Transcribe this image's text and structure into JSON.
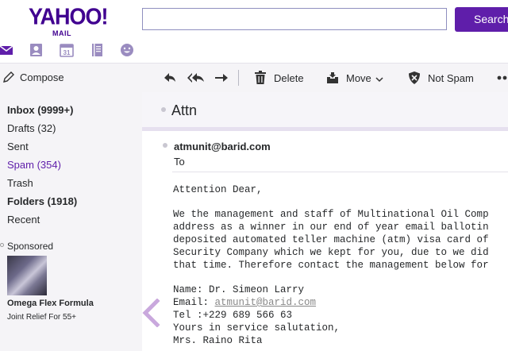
{
  "logo": {
    "word": "YAHOO!",
    "sub": "MAIL"
  },
  "search": {
    "placeholder": "",
    "button_label": "Search"
  },
  "apps": [
    "mail-icon",
    "contacts-icon",
    "calendar-icon",
    "notepad-icon",
    "messenger-icon"
  ],
  "calendar_day": "31",
  "toolbar": {
    "compose": "Compose",
    "delete": "Delete",
    "move": "Move",
    "not_spam": "Not Spam"
  },
  "sidebar": {
    "folders": [
      {
        "label": "Inbox (9999+)",
        "style": "bold"
      },
      {
        "label": "Drafts (32)",
        "style": "normal"
      },
      {
        "label": "Sent",
        "style": "normal"
      },
      {
        "label": "Spam (354)",
        "style": "spam"
      },
      {
        "label": "Trash",
        "style": "normal"
      },
      {
        "label": "Folders (1918)",
        "style": "bold"
      },
      {
        "label": "Recent",
        "style": "normal"
      }
    ],
    "sponsored": "Sponsored",
    "ad": {
      "title": "Omega Flex Formula",
      "subtitle": "Joint Relief For 55+"
    }
  },
  "message": {
    "subject": "Attn",
    "sender": "atmunit@barid.com",
    "to": "To",
    "body": [
      "Attention Dear,",
      "",
      "We the management and staff of Multinational Oil Comp",
      "address as a winner in our end of year email ballotin",
      "deposited automated teller machine (atm) visa card of",
      "Security Company which we kept for you, due to we did",
      "that time. Therefore contact the management below for",
      "",
      "Name: Dr. Simeon Larry"
    ],
    "email_prefix": "Email: ",
    "email_link": "atmunit@barid.com",
    "tail": [
      "Tel :+229 689 566 63",
      "Yours in service salutation,",
      "Mrs. Raino Rita"
    ]
  },
  "colors": {
    "brand": "#5f1eaa",
    "logo": "#400090",
    "sidebar_bg": "#f5f4f7"
  }
}
